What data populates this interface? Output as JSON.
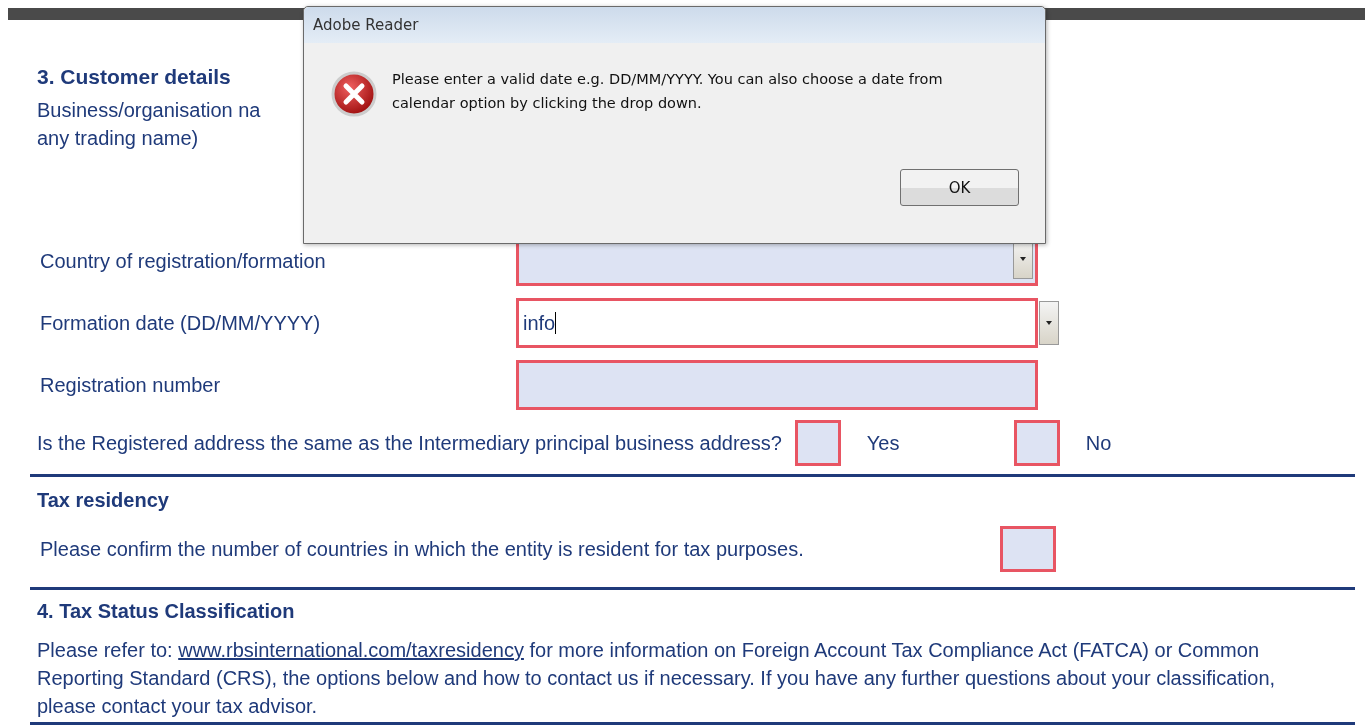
{
  "customer_details": {
    "title": "3. Customer details",
    "name_label_lines": [
      "Business/organisation na",
      "any trading name)"
    ],
    "fields": [
      {
        "label": "Country of registration/formation",
        "kind": "dropdown",
        "invalid": true,
        "focused": false
      },
      {
        "label": "Formation date (DD/MM/YYYY)",
        "kind": "date",
        "value": "info",
        "invalid": true,
        "focused": true
      },
      {
        "label": "Registration number",
        "kind": "text",
        "invalid": true,
        "focused": false
      }
    ],
    "question": {
      "text": "Is the Registered address the same as the Intermediary principal business address?",
      "options": [
        {
          "label": "Yes",
          "checked": false,
          "invalid": true
        },
        {
          "label": "No",
          "checked": false,
          "invalid": true
        }
      ]
    }
  },
  "tax_residency": {
    "title": "Tax residency",
    "prompt": "Please confirm the number of countries in which the entity is resident for tax purposes.",
    "invalid": true
  },
  "tax_status": {
    "title": "4. Tax Status Classification",
    "intro": "Please refer to:",
    "link": "www.rbsinternational.com/taxresidency",
    "rest": "for more information on Foreign Account Tax Compliance Act (FATCA) or Common Reporting Standard (CRS), the options below and how to contact us if necessary. If you have any further questions about your classification, please contact your tax advisor."
  },
  "dialog": {
    "title": "Adobe Reader",
    "kind": "error",
    "message_lines": [
      "Please enter a valid date e.g. DD/MM/YYYY. You can also choose a date from",
      "calendar option by clicking the drop down."
    ],
    "buttons": [
      "OK"
    ]
  }
}
